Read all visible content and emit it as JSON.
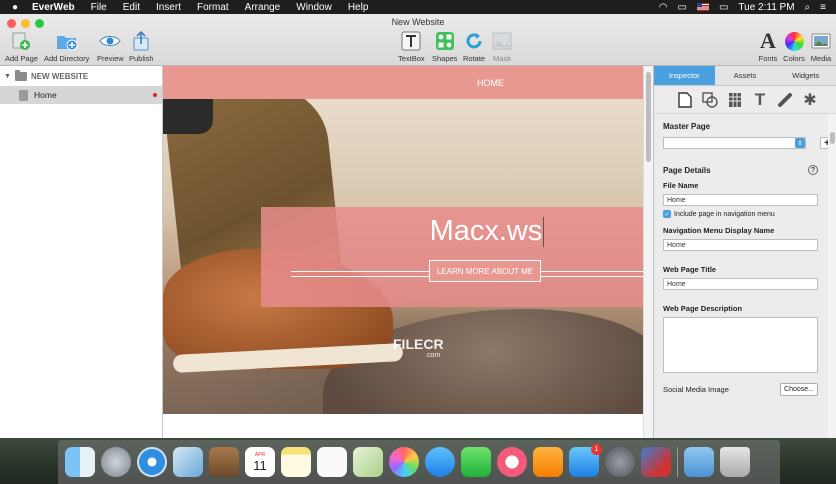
{
  "menubar": {
    "app": "EverWeb",
    "items": [
      "File",
      "Edit",
      "Insert",
      "Format",
      "Arrange",
      "Window",
      "Help"
    ],
    "time": "Tue 2:11 PM"
  },
  "window": {
    "title": "New Website"
  },
  "toolbar": {
    "add_page": "Add Page",
    "add_directory": "Add Directory",
    "preview": "Preview",
    "publish": "Publish",
    "textbox": "TextBox",
    "shapes": "Shapes",
    "rotate": "Rotate",
    "mask": "Mask",
    "fonts": "Fonts",
    "colors": "Colors",
    "media": "Media"
  },
  "sidebar": {
    "website": "NEW WEBSITE",
    "pages": [
      {
        "label": "Home"
      }
    ]
  },
  "canvas": {
    "nav_item": "HOME",
    "hero_title": "Macx.ws",
    "hero_button": "LEARN MORE ABOUT ME",
    "watermark": "FILECR",
    "watermark_sub": ".com"
  },
  "inspector": {
    "tabs": [
      "Inspector",
      "Assets",
      "Widgets"
    ],
    "master_page_label": "Master Page",
    "master_page_value": "",
    "page_details_label": "Page Details",
    "file_name_label": "File Name",
    "file_name_value": "Home",
    "include_nav_label": "Include page in navigation menu",
    "nav_display_label": "Navigation Menu Display Name",
    "nav_display_value": "Home",
    "web_title_label": "Web Page Title",
    "web_title_value": "Home",
    "web_desc_label": "Web Page Description",
    "social_image_label": "Social Media Image",
    "choose_button": "Choose..."
  },
  "dock": {
    "calendar_month": "APR",
    "calendar_day": "11",
    "appstore_badge": "1"
  },
  "colors": {
    "accent": "#4a9fe0",
    "nav_pink": "#e89890",
    "close": "#fc5f57",
    "minimize": "#fdbc2e",
    "maximize": "#28c840"
  }
}
